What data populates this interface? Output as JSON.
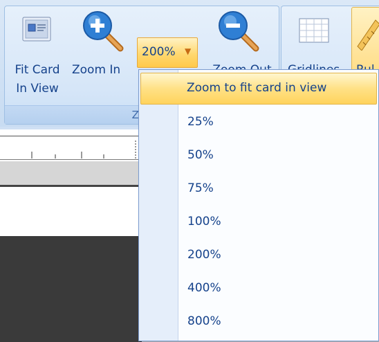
{
  "ribbon": {
    "zoom_group": {
      "label": "Zoo",
      "fit_card_label_line1": "Fit Card",
      "fit_card_label_line2": "In View",
      "zoom_in_label": "Zoom In",
      "zoom_out_label": "Zoom Out",
      "zoom_combo_value": "200%"
    },
    "view_group": {
      "gridlines_label": "Gridlines",
      "ruler_label": "Rul"
    }
  },
  "zoom_menu": {
    "items": [
      "Zoom to fit card in view",
      "25%",
      "50%",
      "75%",
      "100%",
      "200%",
      "400%",
      "800%"
    ]
  },
  "colors": {
    "ribbon_text": "#15428b",
    "highlight": "#ffd35d",
    "canvas_dark": "#3a3a3a"
  }
}
